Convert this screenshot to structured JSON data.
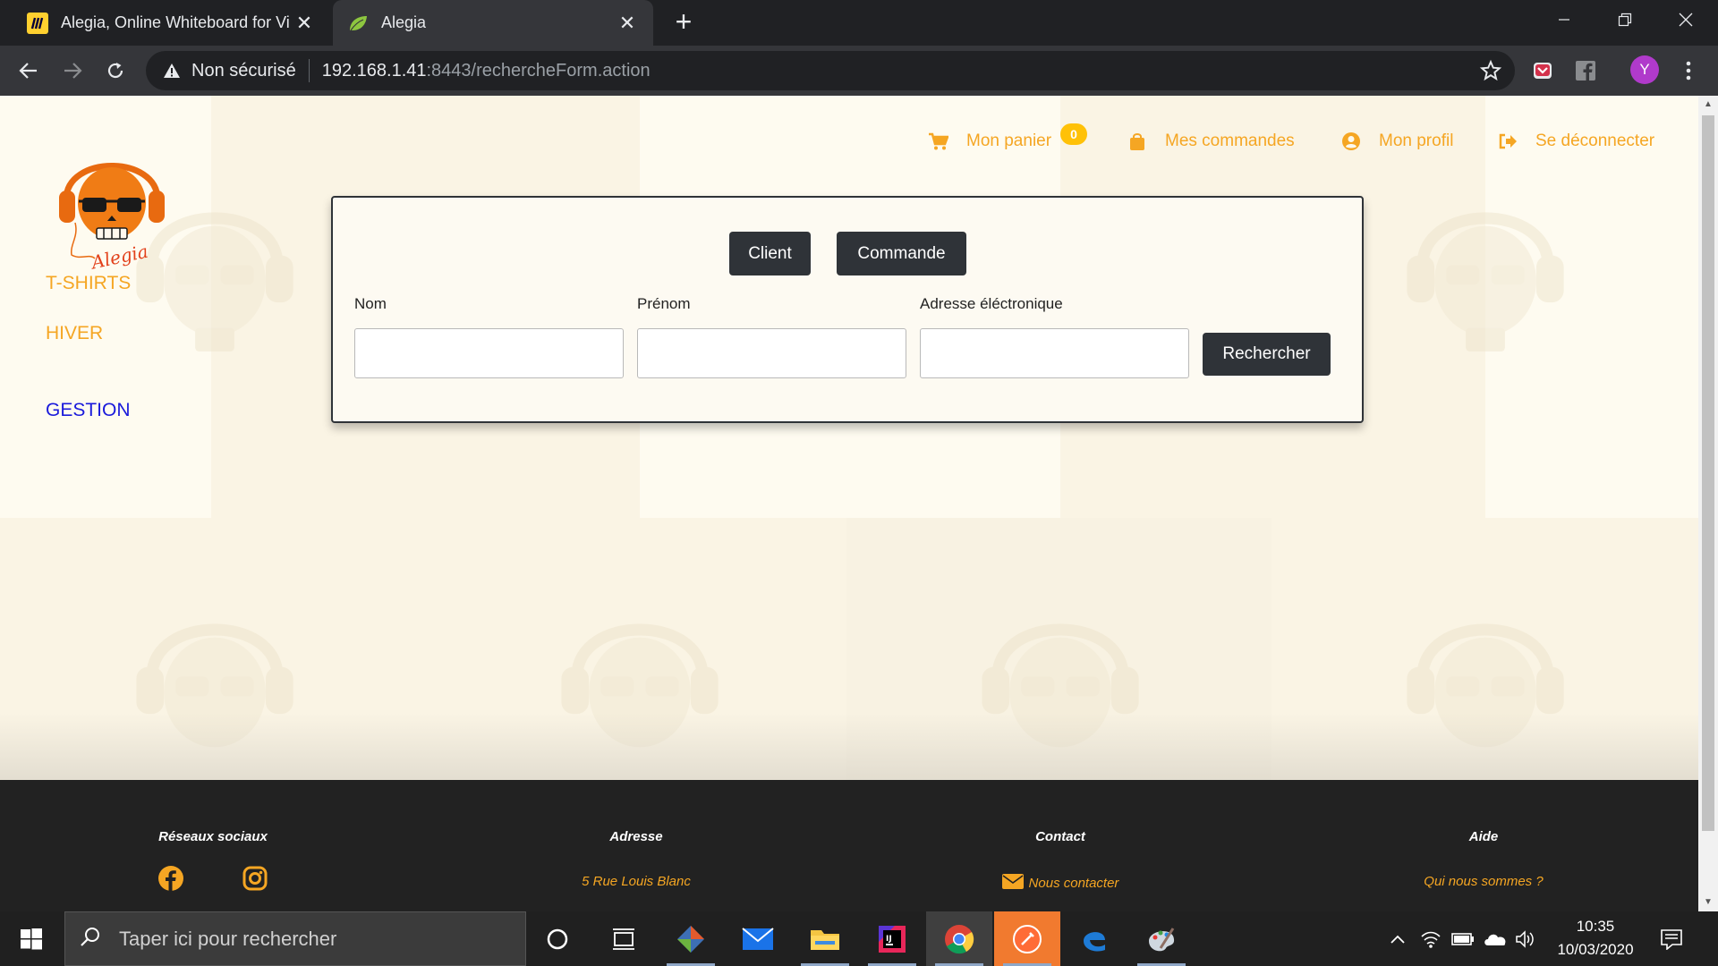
{
  "browser": {
    "tabs": [
      {
        "title": "Alegia, Online Whiteboard for Vi",
        "icon": "miro-icon"
      },
      {
        "title": "Alegia",
        "icon": "spring-leaf-icon",
        "active": true
      }
    ],
    "address": {
      "security": "Non sécurisé",
      "host": "192.168.1.41",
      "path": ":8443/rechercheForm.action"
    },
    "profile_initial": "Y"
  },
  "header": {
    "nav": [
      {
        "label": "Mon panier",
        "icon": "cart-icon"
      },
      {
        "label": "Mes commandes",
        "icon": "shopping-bag-icon"
      },
      {
        "label": "Mon profil",
        "icon": "user-circle-icon"
      },
      {
        "label": "Se déconnecter",
        "icon": "sign-out-icon"
      }
    ],
    "cart_count": "0",
    "logo_text": "Alegia"
  },
  "sidebar": {
    "links": [
      {
        "label": "T-SHIRTS"
      },
      {
        "label": "HIVER"
      },
      {
        "label": "GESTION"
      }
    ]
  },
  "search": {
    "tabs": [
      "Client",
      "Commande"
    ],
    "fields": [
      {
        "label": "Nom",
        "value": ""
      },
      {
        "label": "Prénom",
        "value": ""
      },
      {
        "label": "Adresse éléctronique",
        "value": ""
      }
    ],
    "submit": "Rechercher"
  },
  "footer": {
    "columns": [
      {
        "heading": "Réseaux sociaux"
      },
      {
        "heading": "Adresse",
        "text": "5 Rue Louis Blanc"
      },
      {
        "heading": "Contact",
        "text": "Nous contacter"
      },
      {
        "heading": "Aide",
        "text": "Qui nous sommes ?"
      }
    ]
  },
  "taskbar": {
    "search_placeholder": "Taper ici pour rechercher",
    "time": "10:35",
    "date": "10/03/2020"
  },
  "colors": {
    "accent": "#f5a623",
    "page_bg": "#fdf9ec",
    "dark_button": "#2f3338",
    "gestion_link": "#1a1adb",
    "footer_bg": "#222222"
  }
}
